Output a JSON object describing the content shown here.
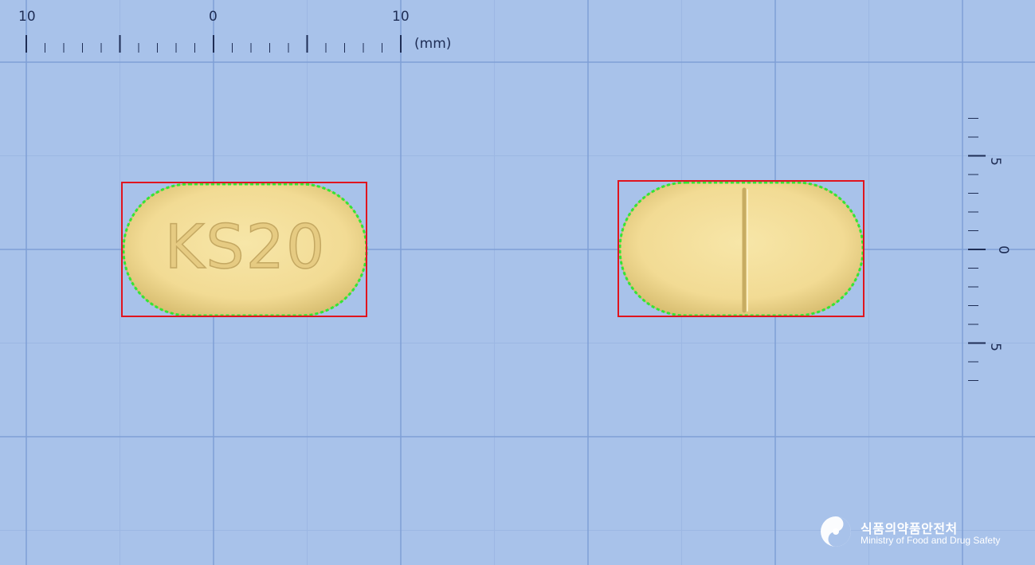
{
  "ruler_top": {
    "labels": [
      "10",
      "0",
      "10"
    ],
    "unit": "(mm)"
  },
  "ruler_right": {
    "labels": [
      "5",
      "0",
      "5"
    ]
  },
  "pill_front": {
    "imprint": "KS20",
    "color": "#f3dd96"
  },
  "pill_back": {
    "marking": "score-line",
    "color": "#f3dd96"
  },
  "overlay": {
    "box_color": "#e0141e",
    "contour_color": "#33e633"
  },
  "logo": {
    "korean": "식품의약품안전처",
    "english": "Ministry of Food and Drug Safety",
    "icon": "mfds-emblem-icon"
  }
}
